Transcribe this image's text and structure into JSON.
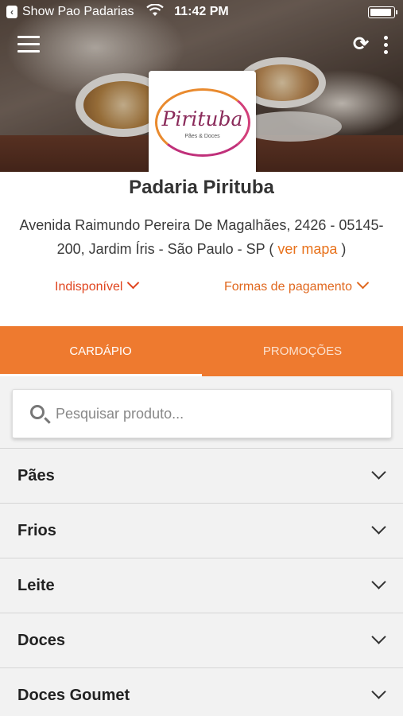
{
  "status_bar": {
    "back_glyph": "‹",
    "carrier": "Show Pao Padarias",
    "time": "11:42 PM"
  },
  "header": {
    "menu_icon": "hamburger-menu-icon",
    "refresh_icon": "refresh-icon",
    "more_icon": "more-vertical-icon"
  },
  "logo": {
    "name": "Pirituba",
    "tagline": "Pães & Doces"
  },
  "store": {
    "name": "Padaria Pirituba",
    "address": "Avenida Raimundo Pereira De Magalhães, 2426 - 05145-200, Jardim Íris - São Paulo - SP ( ",
    "map_link": "ver mapa",
    "address_end": " )",
    "availability": "Indisponível",
    "payment": "Formas de pagamento"
  },
  "tabs": [
    {
      "label": "CARDÁPIO",
      "active": true
    },
    {
      "label": "PROMOÇÕES",
      "active": false
    }
  ],
  "search": {
    "placeholder": "Pesquisar produto..."
  },
  "categories": [
    {
      "label": "Pães"
    },
    {
      "label": "Frios"
    },
    {
      "label": "Leite"
    },
    {
      "label": "Doces"
    },
    {
      "label": "Doces Goumet"
    }
  ],
  "colors": {
    "accent": "#ee7a2f",
    "link": "#e8721c",
    "status_red": "#e0451f"
  }
}
